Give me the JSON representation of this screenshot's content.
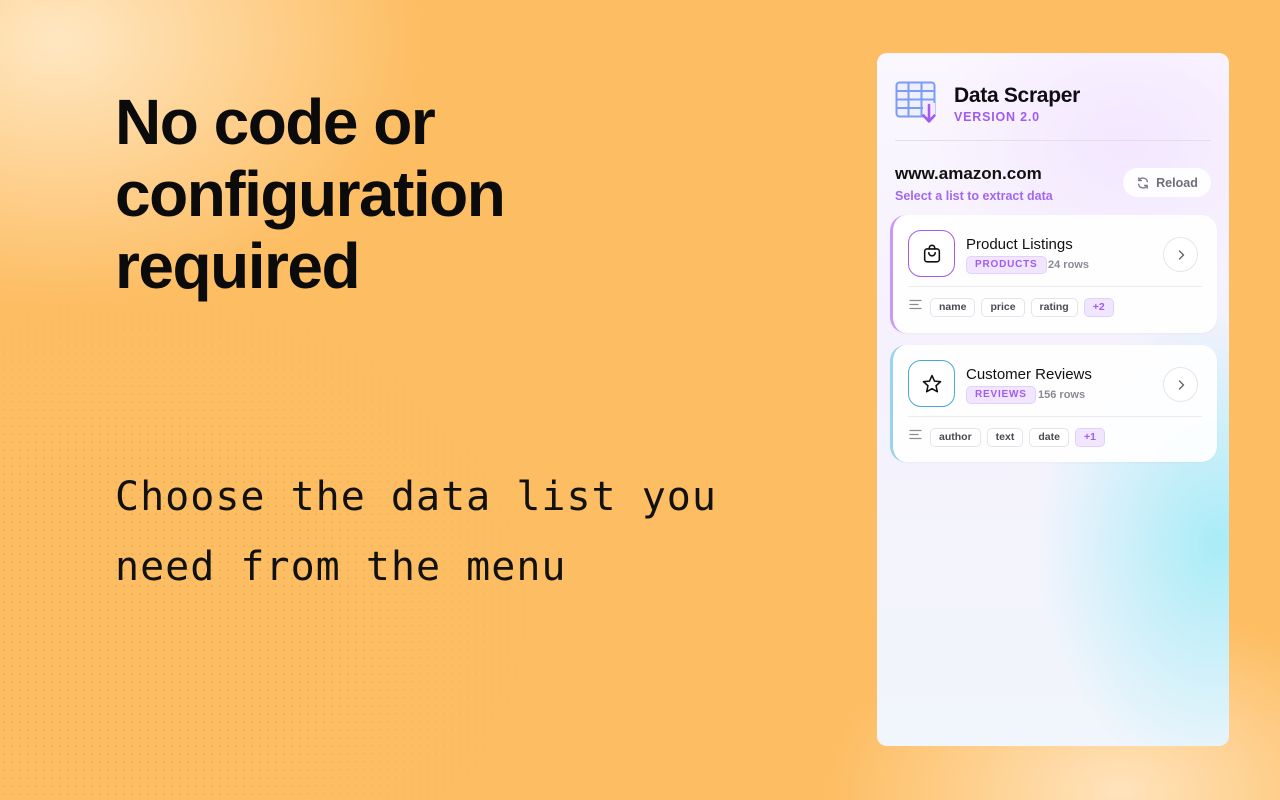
{
  "hero": {
    "headline": "No code or configuration required",
    "subline": "Choose the data list you need from the menu"
  },
  "app": {
    "title": "Data Scraper",
    "version": "VERSION 2.0",
    "logo_icon": "table-download-icon"
  },
  "site": {
    "domain": "www.amazon.com",
    "hint": "Select a list to extract data",
    "reload_label": "Reload"
  },
  "lists": [
    {
      "title": "Product Listings",
      "badge": "PRODUCTS",
      "rows": "24 rows",
      "icon": "shopping-bag-icon",
      "fields": [
        "name",
        "price",
        "rating"
      ],
      "more": "+2"
    },
    {
      "title": "Customer Reviews",
      "badge": "REVIEWS",
      "rows": "156 rows",
      "icon": "star-icon",
      "fields": [
        "author",
        "text",
        "date"
      ],
      "more": "+1"
    }
  ],
  "colors": {
    "background": "#fdbd62",
    "accent": "#a05cf0",
    "accent_blue": "#48a9d6"
  }
}
